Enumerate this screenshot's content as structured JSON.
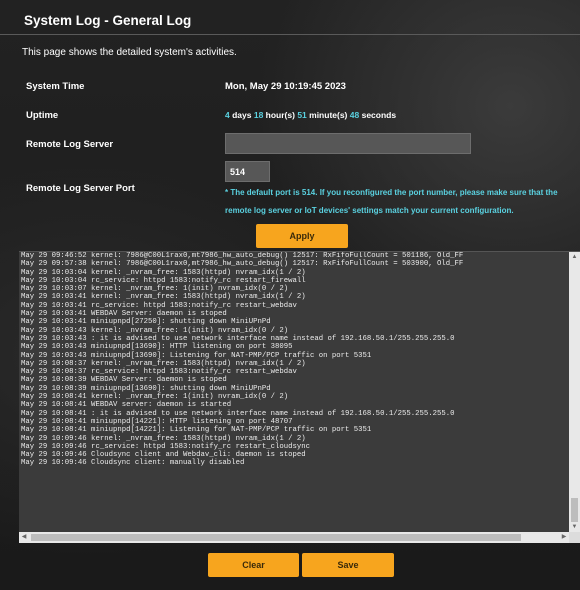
{
  "header": {
    "title": "System Log - General Log",
    "description": "This page shows the detailed system's activities."
  },
  "fields": {
    "system_time_label": "System Time",
    "system_time_value": "Mon, May 29 10:19:45 2023",
    "uptime_label": "Uptime",
    "uptime": {
      "days": "4",
      "days_unit": " days ",
      "hours": "18",
      "hours_unit": " hour(s) ",
      "minutes": "51",
      "minutes_unit": " minute(s) ",
      "seconds": "48",
      "seconds_unit": " seconds"
    },
    "remote_server_label": "Remote Log Server",
    "remote_server_value": "",
    "remote_port_label": "Remote Log Server Port",
    "remote_port_value": "514",
    "port_note": "* The default port is 514. If you reconfigured the port number, please make sure that the remote log server or IoT devices' settings match your current configuration."
  },
  "buttons": {
    "apply": "Apply",
    "clear": "Clear",
    "save": "Save"
  },
  "log": {
    "lines": [
      "May 29 09:46:52 kernel: 7986@C00L1rax0,mt7986_hw_auto_debug() 12517: RxFifoFullCount = 501186, Old_FF",
      "May 29 09:57:38 kernel: 7986@C00L1rax0,mt7986_hw_auto_debug() 12517: RxFifoFullCount = 503900, Old_FF",
      "May 29 10:03:04 kernel: _nvram_free: 1583(httpd) nvram_idx(1 / 2)",
      "May 29 10:03:04 rc_service: httpd 1583:notify_rc restart_firewall",
      "May 29 10:03:07 kernel: _nvram_free: 1(init) nvram_idx(0 / 2)",
      "May 29 10:03:41 kernel: _nvram_free: 1583(httpd) nvram_idx(1 / 2)",
      "May 29 10:03:41 rc_service: httpd 1583:notify_rc restart_webdav",
      "May 29 10:03:41 WEBDAV Server: daemon is stoped",
      "May 29 10:03:41 miniupnpd[27250]: shutting down MiniUPnPd",
      "May 29 10:03:43 kernel: _nvram_free: 1(init) nvram_idx(0 / 2)",
      "May 29 10:03:43 : it is advised to use network interface name instead of 192.168.50.1/255.255.255.0",
      "May 29 10:03:43 miniupnpd[13690]: HTTP listening on port 38095",
      "May 29 10:03:43 miniupnpd[13690]: Listening for NAT-PMP/PCP traffic on port 5351",
      "May 29 10:08:37 kernel: _nvram_free: 1583(httpd) nvram_idx(1 / 2)",
      "May 29 10:08:37 rc_service: httpd 1583:notify_rc restart_webdav",
      "May 29 10:08:39 WEBDAV Server: daemon is stoped",
      "May 29 10:08:39 miniupnpd[13690]: shutting down MiniUPnPd",
      "May 29 10:08:41 kernel: _nvram_free: 1(init) nvram_idx(0 / 2)",
      "May 29 10:08:41 WEBDAV server: daemon is started",
      "May 29 10:08:41 : it is advised to use network interface name instead of 192.168.50.1/255.255.255.0",
      "May 29 10:08:41 miniupnpd[14221]: HTTP listening on port 48707",
      "May 29 10:08:41 miniupnpd[14221]: Listening for NAT-PMP/PCP traffic on port 5351",
      "May 29 10:09:46 kernel: _nvram_free: 1583(httpd) nvram_idx(1 / 2)",
      "May 29 10:09:46 rc_service: httpd 1583:notify_rc restart_cloudsync",
      "May 29 10:09:46 Cloudsync client and Webdav_cli: daemon is stoped",
      "May 29 10:09:46 Cloudsync client: manually disabled"
    ]
  },
  "colors": {
    "accent_button": "#f7a51e",
    "highlight_text": "#5ad1e0"
  },
  "icons": {
    "scroll_up": "triangle-up",
    "scroll_down": "triangle-down",
    "scroll_left": "triangle-left",
    "scroll_right": "triangle-right"
  }
}
